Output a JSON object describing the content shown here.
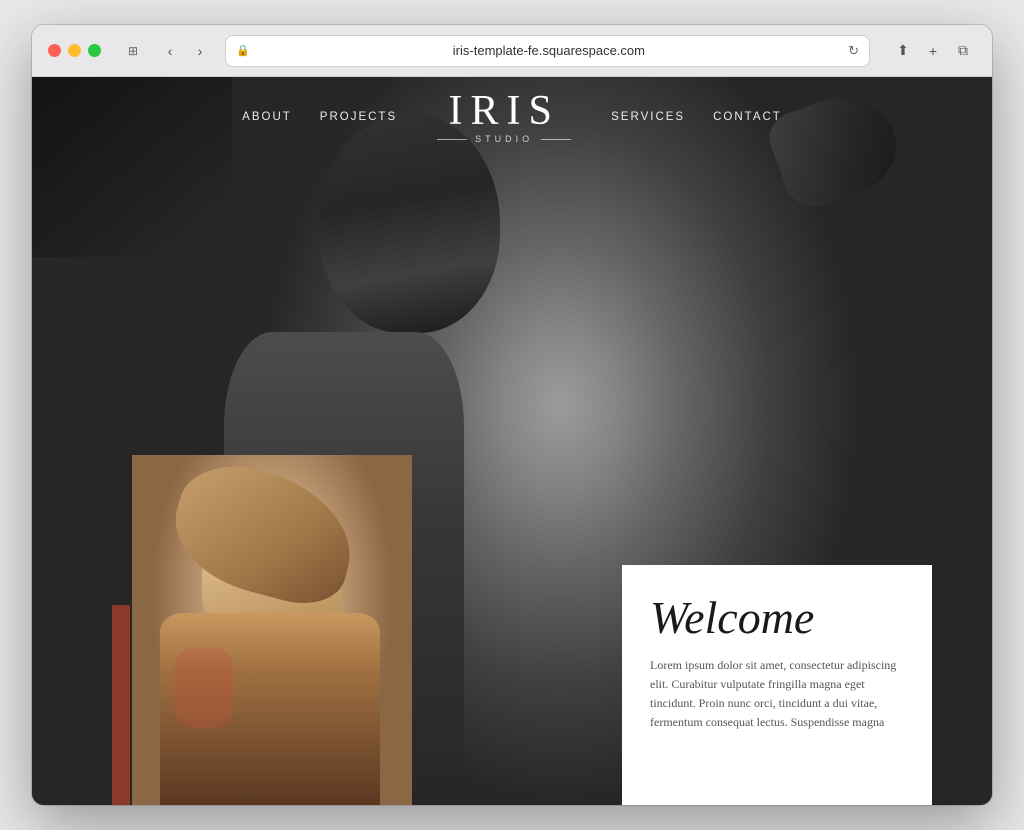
{
  "browser": {
    "address": "iris-template-fe.squarespace.com",
    "back_label": "‹",
    "forward_label": "›",
    "refresh_label": "↻",
    "share_label": "⎋",
    "new_tab_label": "+",
    "duplicate_label": "⧉"
  },
  "nav": {
    "links_left": [
      "ABOUT",
      "PROJECTS"
    ],
    "logo_title": "IRIS",
    "logo_subtitle": "STUDIO",
    "links_right": [
      "SERVICES",
      "CONTACT"
    ]
  },
  "welcome": {
    "title": "Welcome",
    "body": "Lorem ipsum dolor sit amet, consectetur adipiscing elit. Curabitur vulputate fringilla magna eget tincidunt. Proin nunc orci, tincidunt a dui vitae, fermentum consequat lectus. Suspendisse magna"
  }
}
